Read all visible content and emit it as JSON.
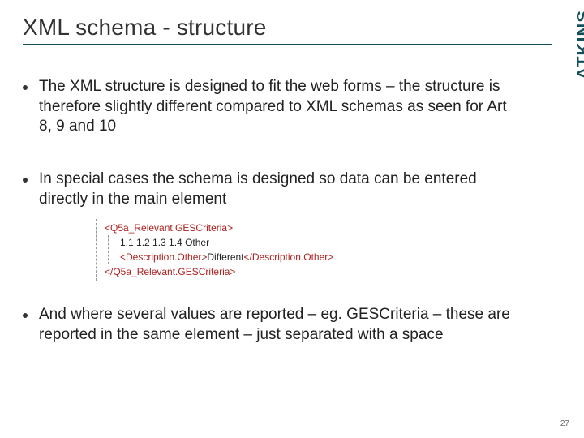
{
  "title": "XML schema - structure",
  "bullets": [
    "The XML structure is designed to fit the web forms – the structure is therefore slightly different compared to XML schemas as seen for Art 8, 9 and 10",
    "In special cases the schema is designed so data can be entered directly in the main element",
    "And where several values are reported – eg. GESCriteria – these are reported in the same element – just separated with a space"
  ],
  "code": {
    "open_outer": "<Q5a_Relevant.GESCriteria>",
    "line_values": "1.1 1.2 1.3 1.4 Other",
    "inner_open": "<Description.Other>",
    "inner_text": "Different",
    "inner_close": "</Description.Other>",
    "close_outer": "</Q5a_Relevant.GESCriteria>"
  },
  "logo_text": "ATKINS",
  "page_number": "27"
}
